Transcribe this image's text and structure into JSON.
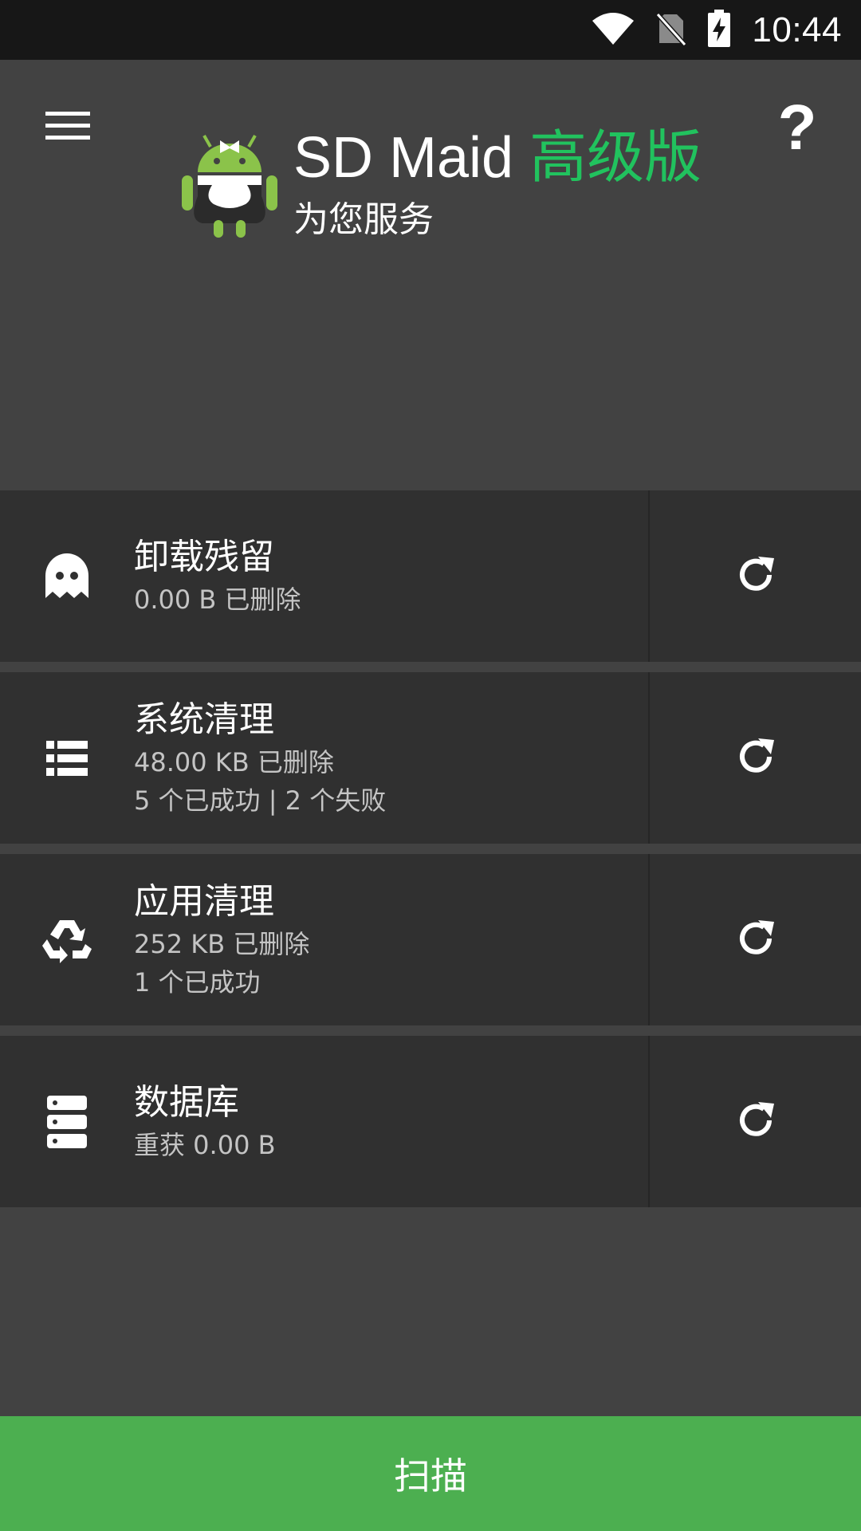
{
  "status_bar": {
    "time": "10:44",
    "icons": [
      "wifi-icon",
      "no-sim-icon",
      "battery-charging-icon"
    ]
  },
  "header": {
    "menu_icon": "menu-icon",
    "help_label": "?",
    "app_name": "SD Maid",
    "edition": "高级版",
    "subtitle": "为您服务",
    "edition_color": "#21c25e"
  },
  "cards": [
    {
      "icon": "ghost-icon",
      "title": "卸载残留",
      "lines": [
        "0.00 B 已删除"
      ],
      "action_icon": "refresh-icon"
    },
    {
      "icon": "list-icon",
      "title": "系统清理",
      "lines": [
        "48.00 KB 已删除",
        "5 个已成功 | 2 个失败"
      ],
      "action_icon": "refresh-icon"
    },
    {
      "icon": "recycle-icon",
      "title": "应用清理",
      "lines": [
        "252 KB 已删除",
        "1 个已成功"
      ],
      "action_icon": "refresh-icon"
    },
    {
      "icon": "database-icon",
      "title": "数据库",
      "lines": [
        "重获 0.00 B"
      ],
      "action_icon": "refresh-icon"
    }
  ],
  "scan_button": {
    "label": "扫描",
    "color": "#4caf50"
  }
}
